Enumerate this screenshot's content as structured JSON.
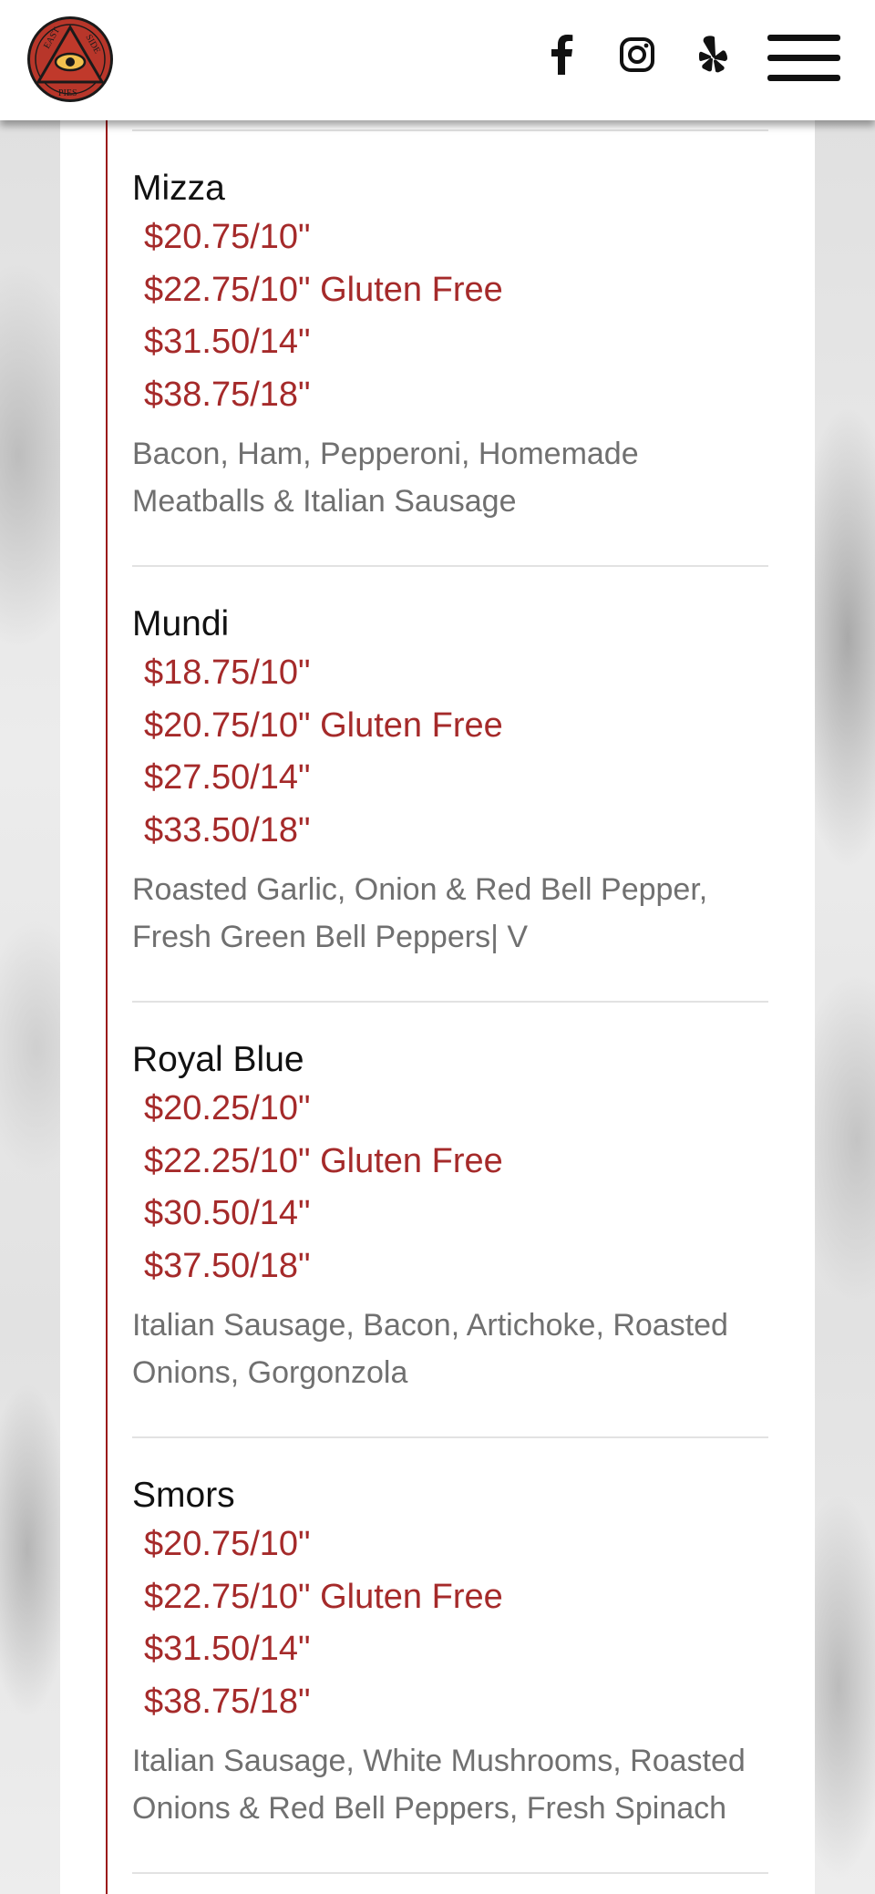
{
  "header": {
    "logo": {
      "text_top_left": "EAST",
      "text_top_right": "SIDE",
      "text_bottom": "PIES",
      "colors": {
        "ring": "#b8362a",
        "triangle": "#c0392b",
        "eye": "#f2c14e",
        "outline": "#1a1a1a"
      }
    },
    "social": [
      {
        "name": "facebook",
        "icon": "facebook-icon"
      },
      {
        "name": "instagram",
        "icon": "instagram-icon"
      },
      {
        "name": "yelp",
        "icon": "yelp-icon"
      }
    ],
    "menu_icon": "hamburger-menu-icon"
  },
  "theme": {
    "price_color": "#a52a2a",
    "accent_line": "#9b1b1b",
    "description_color": "#707070"
  },
  "menu": {
    "items": [
      {
        "name": "Mizza",
        "prices": [
          "$20.75/10\"",
          "$22.75/10\" Gluten Free",
          "$31.50/14\"",
          "$38.75/18\""
        ],
        "description": "Bacon, Ham, Pepperoni, Homemade Meatballs & Italian Sausage"
      },
      {
        "name": "Mundi",
        "prices": [
          "$18.75/10\"",
          "$20.75/10\" Gluten Free",
          "$27.50/14\"",
          "$33.50/18\""
        ],
        "description": "Roasted Garlic, Onion & Red Bell Pepper, Fresh Green Bell Peppers| V"
      },
      {
        "name": "Royal Blue",
        "prices": [
          "$20.25/10\"",
          "$22.25/10\" Gluten Free",
          "$30.50/14\"",
          "$37.50/18\""
        ],
        "description": "Italian Sausage, Bacon, Artichoke, Roasted Onions, Gorgonzola"
      },
      {
        "name": "Smors",
        "prices": [
          "$20.75/10\"",
          "$22.75/10\" Gluten Free",
          "$31.50/14\"",
          "$38.75/18\""
        ],
        "description": "Italian Sausage, White Mushrooms, Roasted Onions & Red Bell Peppers, Fresh Spinach"
      }
    ]
  }
}
